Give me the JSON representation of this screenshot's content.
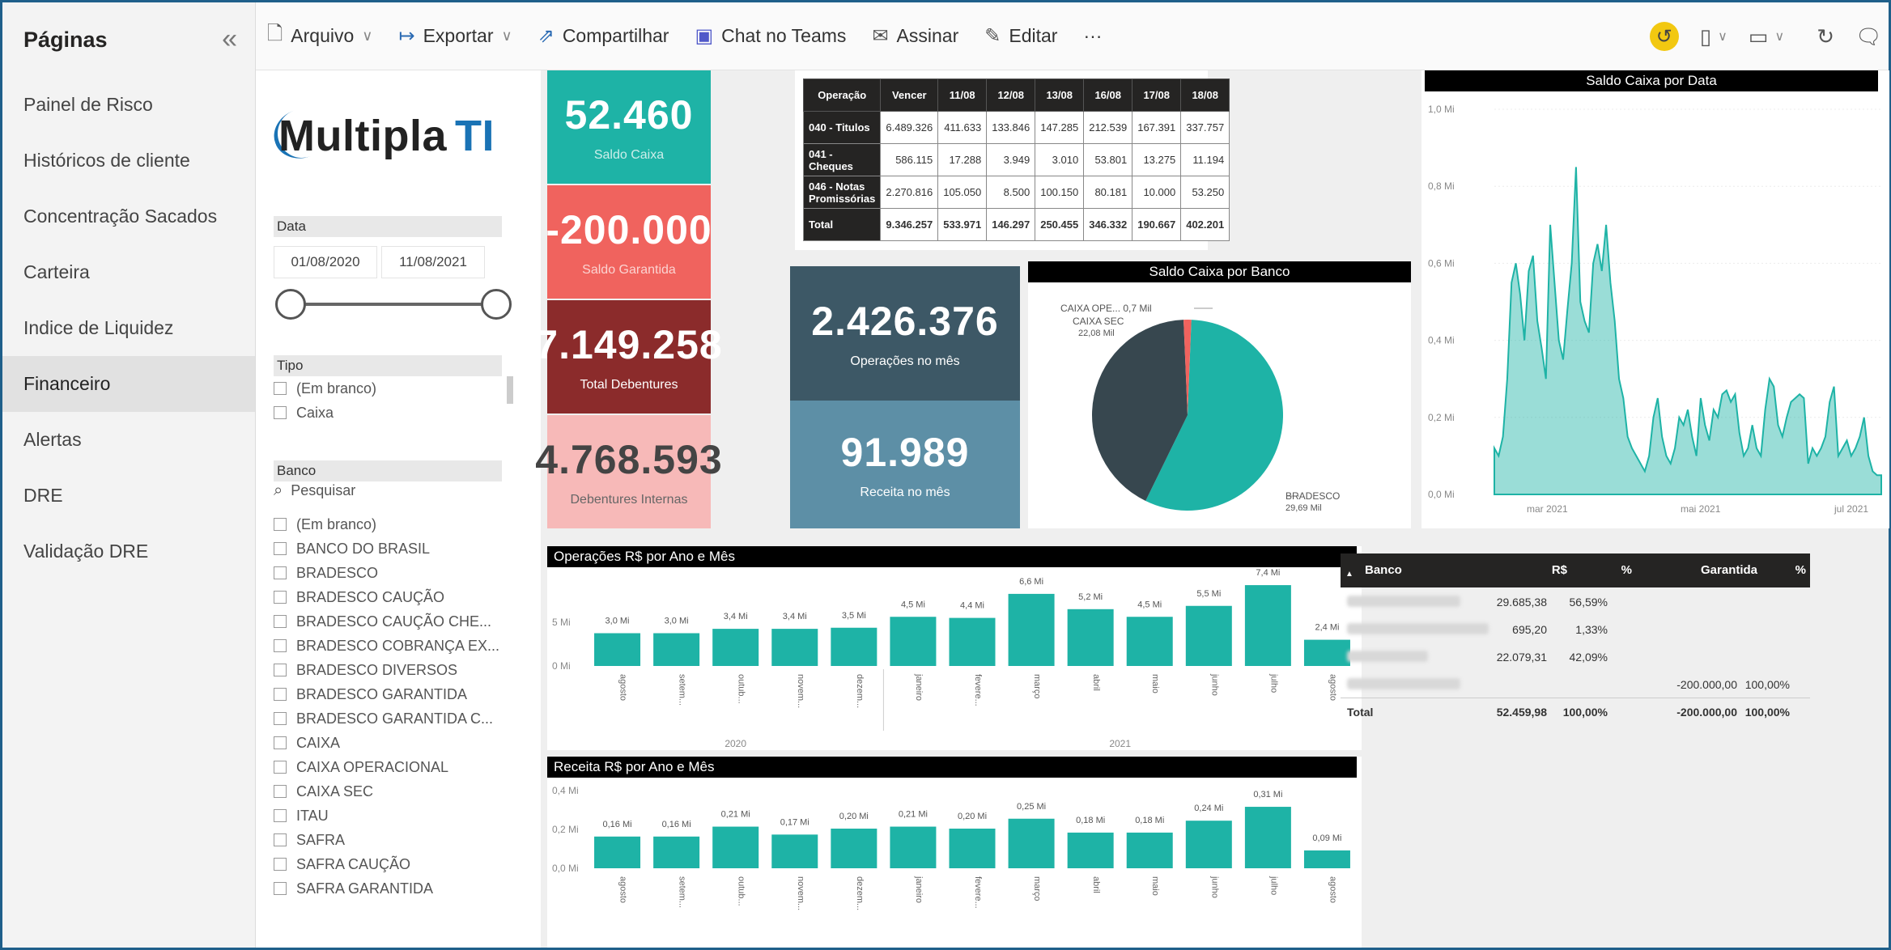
{
  "pages": {
    "title": "Páginas",
    "items": [
      {
        "label": "Painel de Risco"
      },
      {
        "label": "Históricos de cliente"
      },
      {
        "label": "Concentração Sacados"
      },
      {
        "label": "Carteira"
      },
      {
        "label": "Indice de Liquidez"
      },
      {
        "label": "Financeiro",
        "active": true
      },
      {
        "label": "Alertas"
      },
      {
        "label": "DRE"
      },
      {
        "label": "Validação DRE"
      }
    ]
  },
  "toolbar": {
    "arquivo": "Arquivo",
    "exportar": "Exportar",
    "compartilhar": "Compartilhar",
    "chat": "Chat no Teams",
    "assinar": "Assinar",
    "editar": "Editar",
    "more": "···"
  },
  "logo": {
    "text": "Multipla",
    "accent": "TI"
  },
  "filters": {
    "data_label": "Data",
    "date_from": "01/08/2020",
    "date_to": "11/08/2021",
    "tipo_label": "Tipo",
    "tipo_items": [
      "(Em branco)",
      "Caixa"
    ],
    "banco_label": "Banco",
    "search_placeholder": "Pesquisar",
    "banco_items": [
      "(Em branco)",
      "BANCO DO BRASIL",
      "BRADESCO",
      "BRADESCO CAUÇÃO",
      "BRADESCO CAUÇÃO CHE...",
      "BRADESCO COBRANÇA EX...",
      "BRADESCO DIVERSOS",
      "BRADESCO GARANTIDA",
      "BRADESCO GARANTIDA C...",
      "CAIXA",
      "CAIXA OPERACIONAL",
      "CAIXA SEC",
      "ITAU",
      "SAFRA",
      "SAFRA CAUÇÃO",
      "SAFRA GARANTIDA"
    ]
  },
  "kpis": {
    "saldo_caixa": {
      "value": "52.460",
      "label": "Saldo Caixa",
      "color": "#1eb3a6"
    },
    "saldo_garantida": {
      "value": "-200.000",
      "label": "Saldo Garantida",
      "color": "#f0635e"
    },
    "total_debentures": {
      "value": "7.149.258",
      "label": "Total Debentures",
      "color": "#8b2b2b"
    },
    "debentures_internas": {
      "value": "4.768.593",
      "label": "Debentures Internas",
      "color": "#f7b9b8"
    },
    "operacoes_mes": {
      "value": "2.426.376",
      "label": "Operações no mês",
      "color": "#3d5866"
    },
    "receita_mes": {
      "value": "91.989",
      "label": "Receita no mês",
      "color": "#5d8fa6"
    }
  },
  "op_table": {
    "headers": [
      "Operação",
      "Vencer",
      "11/08",
      "12/08",
      "13/08",
      "16/08",
      "17/08",
      "18/08"
    ],
    "rows": [
      {
        "name": "040 - Titulos",
        "values": [
          "6.489.326",
          "411.633",
          "133.846",
          "147.285",
          "212.539",
          "167.391",
          "337.757"
        ]
      },
      {
        "name": "041 - Cheques",
        "values": [
          "586.115",
          "17.288",
          "3.949",
          "3.010",
          "53.801",
          "13.275",
          "11.194"
        ]
      },
      {
        "name": "046 - Notas Promissórias",
        "values": [
          "2.270.816",
          "105.050",
          "8.500",
          "100.150",
          "80.181",
          "10.000",
          "53.250"
        ]
      }
    ],
    "total": {
      "name": "Total",
      "values": [
        "9.346.257",
        "533.971",
        "146.297",
        "250.455",
        "346.332",
        "190.667",
        "402.201"
      ]
    }
  },
  "pie": {
    "title": "Saldo Caixa por Banco",
    "labels": [
      {
        "name": "CAIXA OPE...",
        "value": "0,7 Mil"
      },
      {
        "name": "CAIXA SEC",
        "value": "22,08 Mil"
      },
      {
        "name": "BRADESCO",
        "value": "29,69 Mil"
      }
    ],
    "colors": [
      "#1eb3a6",
      "#37474f",
      "#f0635e"
    ]
  },
  "chart_data": [
    {
      "type": "area",
      "title": "Saldo Caixa por Data",
      "y_ticks": [
        "1,0 Mi",
        "0,8 Mi",
        "0,6 Mi",
        "0,4 Mi",
        "0,2 Mi",
        "0,0 Mi"
      ],
      "x_ticks": [
        "mar 2021",
        "mai 2021",
        "jul 2021"
      ],
      "ylim": [
        0,
        1.0
      ],
      "values": [
        0.12,
        0.1,
        0.15,
        0.3,
        0.55,
        0.6,
        0.52,
        0.4,
        0.58,
        0.62,
        0.45,
        0.38,
        0.3,
        0.7,
        0.55,
        0.4,
        0.35,
        0.48,
        0.6,
        0.85,
        0.5,
        0.45,
        0.42,
        0.6,
        0.65,
        0.58,
        0.7,
        0.55,
        0.45,
        0.3,
        0.25,
        0.15,
        0.12,
        0.1,
        0.08,
        0.06,
        0.1,
        0.2,
        0.25,
        0.15,
        0.1,
        0.08,
        0.12,
        0.2,
        0.18,
        0.22,
        0.15,
        0.1,
        0.25,
        0.18,
        0.14,
        0.22,
        0.2,
        0.26,
        0.27,
        0.24,
        0.26,
        0.16,
        0.1,
        0.12,
        0.18,
        0.12,
        0.1,
        0.22,
        0.3,
        0.28,
        0.18,
        0.15,
        0.2,
        0.24,
        0.25,
        0.26,
        0.25,
        0.08,
        0.12,
        0.1,
        0.12,
        0.15,
        0.24,
        0.28,
        0.1,
        0.12,
        0.14,
        0.1,
        0.12,
        0.15,
        0.2,
        0.1,
        0.06,
        0.05,
        0.05
      ],
      "color": "#1eb3a6"
    },
    {
      "type": "bar",
      "title": "Operações R$ por Ano e Mês",
      "y_ticks": [
        "5 Mi",
        "0 Mi"
      ],
      "ylim": [
        0,
        8
      ],
      "categories": [
        "agosto",
        "setem...",
        "outub...",
        "novem...",
        "dezem...",
        "janeiro",
        "fevere...",
        "março",
        "abril",
        "maio",
        "junho",
        "julho",
        "agosto"
      ],
      "values": [
        3.0,
        3.0,
        3.4,
        3.4,
        3.5,
        4.5,
        4.4,
        6.6,
        5.2,
        4.5,
        5.5,
        7.4,
        2.4
      ],
      "data_labels": [
        "3,0 Mi",
        "3,0 Mi",
        "3,4 Mi",
        "3,4 Mi",
        "3,5 Mi",
        "4,5 Mi",
        "4,4 Mi",
        "6,6 Mi",
        "5,2 Mi",
        "4,5 Mi",
        "5,5 Mi",
        "7,4 Mi",
        "2,4 Mi"
      ],
      "years": [
        "2020",
        "2021"
      ],
      "color": "#1eb3a6"
    },
    {
      "type": "bar",
      "title": "Receita R$ por Ano e Mês",
      "y_ticks": [
        "0,4 Mi",
        "0,2 Mi",
        "0,0 Mi"
      ],
      "ylim": [
        0,
        0.4
      ],
      "categories": [
        "agosto",
        "setem...",
        "outub...",
        "novem...",
        "dezem...",
        "janeiro",
        "fevere...",
        "março",
        "abril",
        "maio",
        "junho",
        "julho",
        "agosto"
      ],
      "values": [
        0.16,
        0.16,
        0.21,
        0.17,
        0.2,
        0.21,
        0.2,
        0.25,
        0.18,
        0.18,
        0.24,
        0.31,
        0.09
      ],
      "data_labels": [
        "0,16 Mi",
        "0,16 Mi",
        "0,21 Mi",
        "0,17 Mi",
        "0,20 Mi",
        "0,21 Mi",
        "0,20 Mi",
        "0,25 Mi",
        "0,18 Mi",
        "0,18 Mi",
        "0,24 Mi",
        "0,31 Mi",
        "0,09 Mi"
      ],
      "color": "#1eb3a6"
    }
  ],
  "bank_table": {
    "headers": [
      "Banco",
      "R$",
      "%",
      "Garantida",
      "%"
    ],
    "rows": [
      {
        "rs": "29.685,38",
        "pct": "56,59%",
        "gar": "",
        "gpct": ""
      },
      {
        "rs": "695,20",
        "pct": "1,33%",
        "gar": "",
        "gpct": ""
      },
      {
        "rs": "22.079,31",
        "pct": "42,09%",
        "gar": "",
        "gpct": ""
      },
      {
        "rs": "",
        "pct": "",
        "gar": "-200.000,00",
        "gpct": "100,00%"
      }
    ],
    "total": {
      "label": "Total",
      "rs": "52.459,98",
      "pct": "100,00%",
      "gar": "-200.000,00",
      "gpct": "100,00%"
    }
  }
}
